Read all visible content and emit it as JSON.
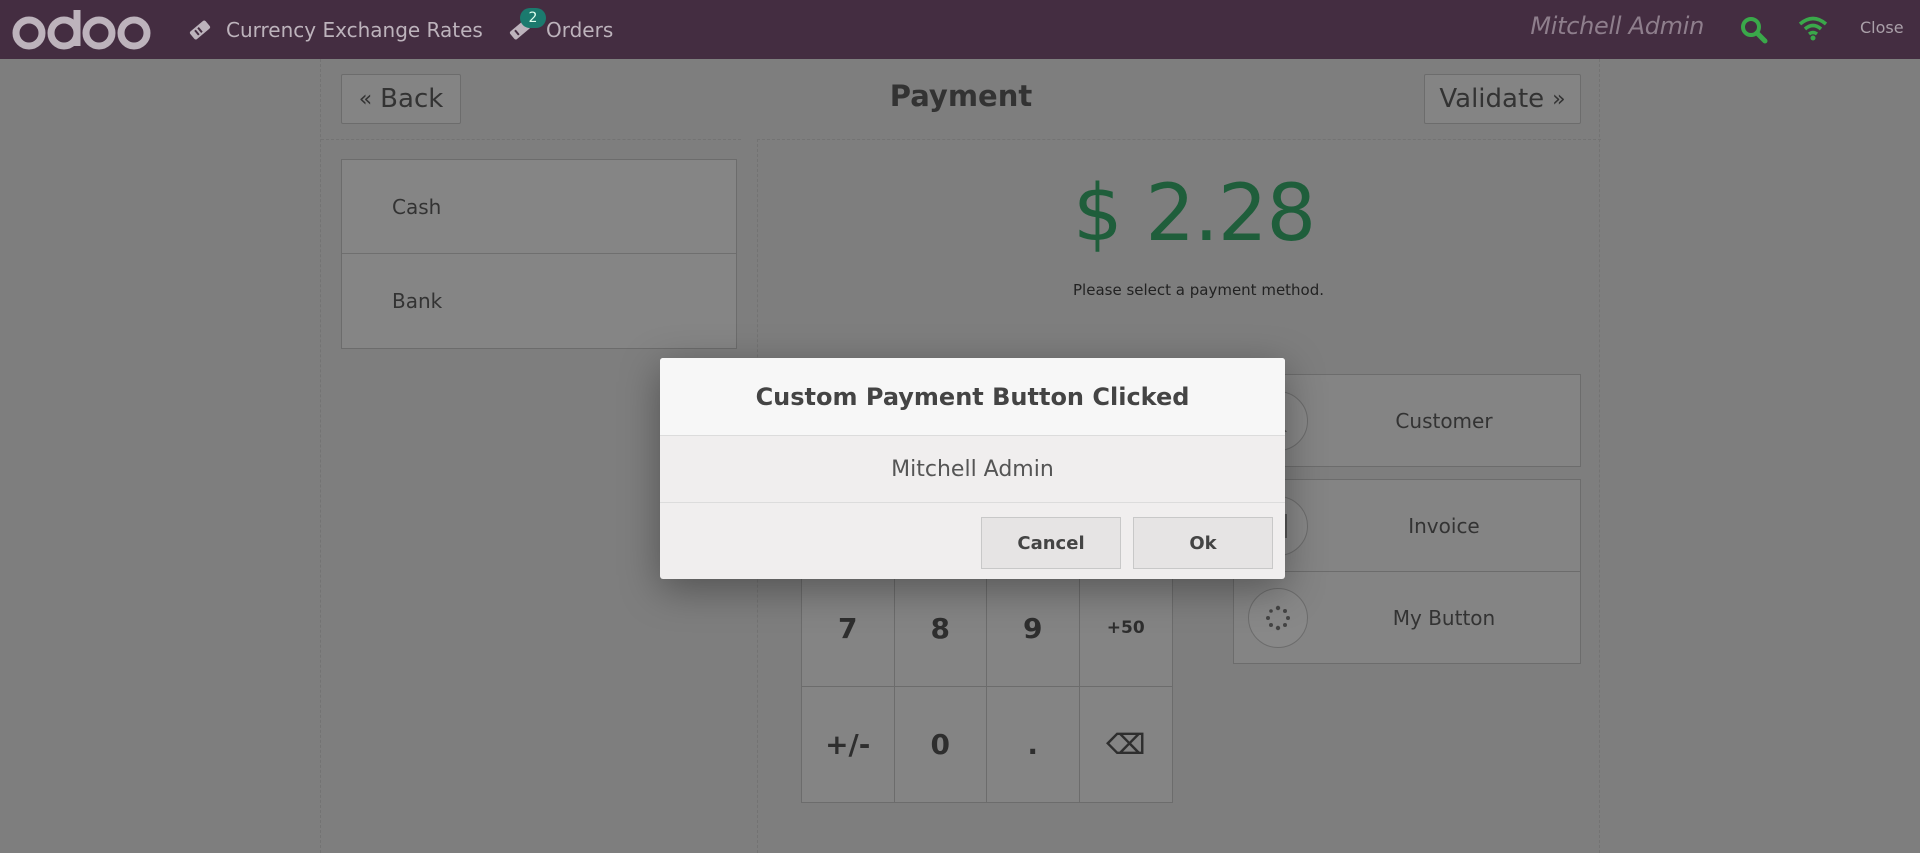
{
  "topbar": {
    "logo_text": "odoo",
    "currency_label": "Currency Exchange Rates",
    "orders_label": "Orders",
    "orders_count": "2",
    "username": "Mitchell Admin",
    "close_label": "Close"
  },
  "payment": {
    "back_label": "Back",
    "title": "Payment",
    "validate_label": "Validate",
    "methods": [
      "Cash",
      "Bank"
    ],
    "amount": "$ 2.28",
    "hint": "Please select a payment method."
  },
  "numpad": {
    "keys": [
      "7",
      "8",
      "9",
      "+50",
      "+/-",
      "0",
      ".",
      "⌫"
    ]
  },
  "extras": {
    "customer_label": "Customer",
    "invoice_label": "Invoice",
    "my_button_label": "My Button"
  },
  "modal": {
    "title": "Custom Payment Button Clicked",
    "body": "Mitchell Admin",
    "cancel_label": "Cancel",
    "ok_label": "Ok"
  },
  "colors": {
    "topbar_bg": "#442d41",
    "amount": "#1f5e3b",
    "status_green": "#3aa84a"
  }
}
